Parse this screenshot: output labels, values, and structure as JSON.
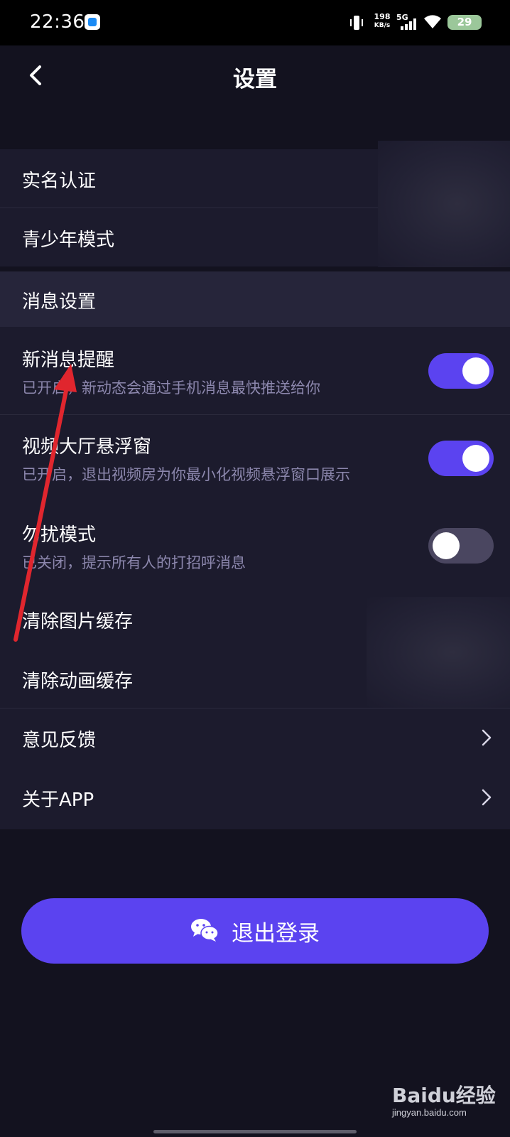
{
  "status_bar": {
    "time": "22:36",
    "net_speed_value": "198",
    "net_speed_unit": "KB/s",
    "network_type": "5G",
    "battery": "29"
  },
  "header": {
    "title": "设置"
  },
  "sections": {
    "real_name": "实名认证",
    "teen_mode": "青少年模式",
    "message_settings_header": "消息设置",
    "new_message": {
      "label": "新消息提醒",
      "description": "已开启，新动态会通过手机消息最快推送给你",
      "toggle": "on"
    },
    "video_float": {
      "label": "视频大厅悬浮窗",
      "description": "已开启，退出视频房为你最小化视频悬浮窗口展示",
      "toggle": "on"
    },
    "dnd": {
      "label": "勿扰模式",
      "description": "已关闭，提示所有人的打招呼消息",
      "toggle": "off"
    },
    "clear_image_cache": "清除图片缓存",
    "clear_animation_cache": "清除动画缓存",
    "feedback": "意见反馈",
    "about": "关于APP"
  },
  "logout": {
    "label": "退出登录",
    "icon": "wechat-icon"
  },
  "watermark": {
    "brand": "Baidu经验",
    "url": "jingyan.baidu.com"
  },
  "colors": {
    "background": "#13121f",
    "row_background": "#1c1b2d",
    "accent": "#5b43f0",
    "subtext": "#8c87ad",
    "annotation_arrow": "#e0262e"
  }
}
